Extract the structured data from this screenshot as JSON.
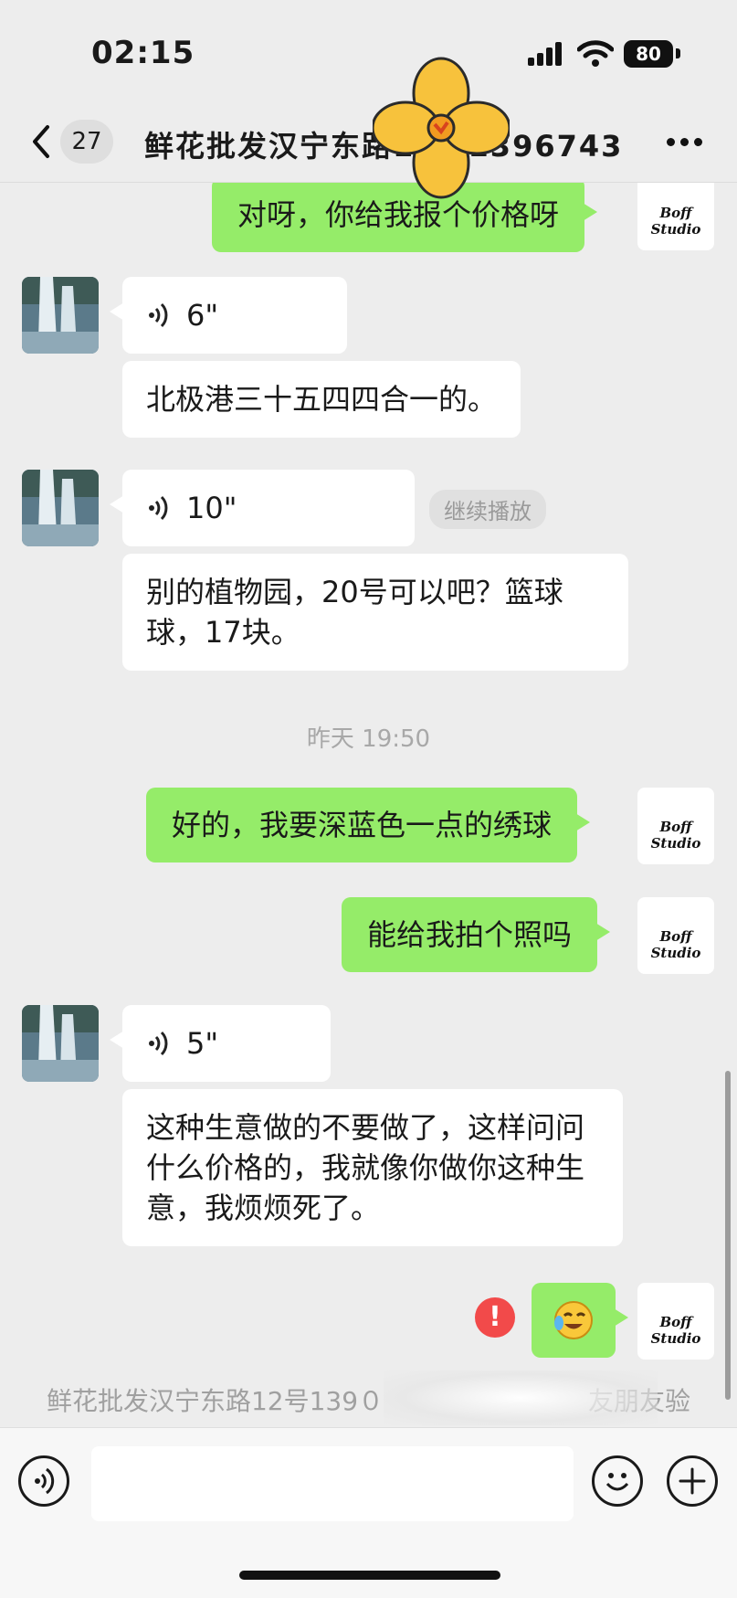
{
  "status_bar": {
    "time": "02:15",
    "battery": "80"
  },
  "nav": {
    "unread_count": "27",
    "title": "鲜花批发汉宁东路12号1396743５"
  },
  "messages": {
    "out_1": "对呀，你给我报个价格呀",
    "in_voice_1": "6\"",
    "in_text_1": "北极港三十五四四合一的。",
    "in_voice_2": "10\"",
    "continue_label": "继续播放",
    "in_text_2": "别的植物园，20号可以吧？篮球球，17块。",
    "timestamp": "昨天 19:50",
    "out_2": "好的，我要深蓝色一点的绣球",
    "out_3": "能给我拍个照吗",
    "in_voice_3": "5\"",
    "in_text_3": "这种生意做的不要做了，这样问问什么价格的，我就像你做你这种生意，我烦烦死了。",
    "fail_mark": "!"
  },
  "avatar_out_label": "Boff Studio",
  "system_note": "鲜花批发汉宁东路12号139０　　　　　　　　友朋友验",
  "colors": {
    "outgoing_bubble": "#95ec69",
    "incoming_bubble": "#ffffff",
    "background": "#ededed",
    "fail": "#f24a4a"
  }
}
